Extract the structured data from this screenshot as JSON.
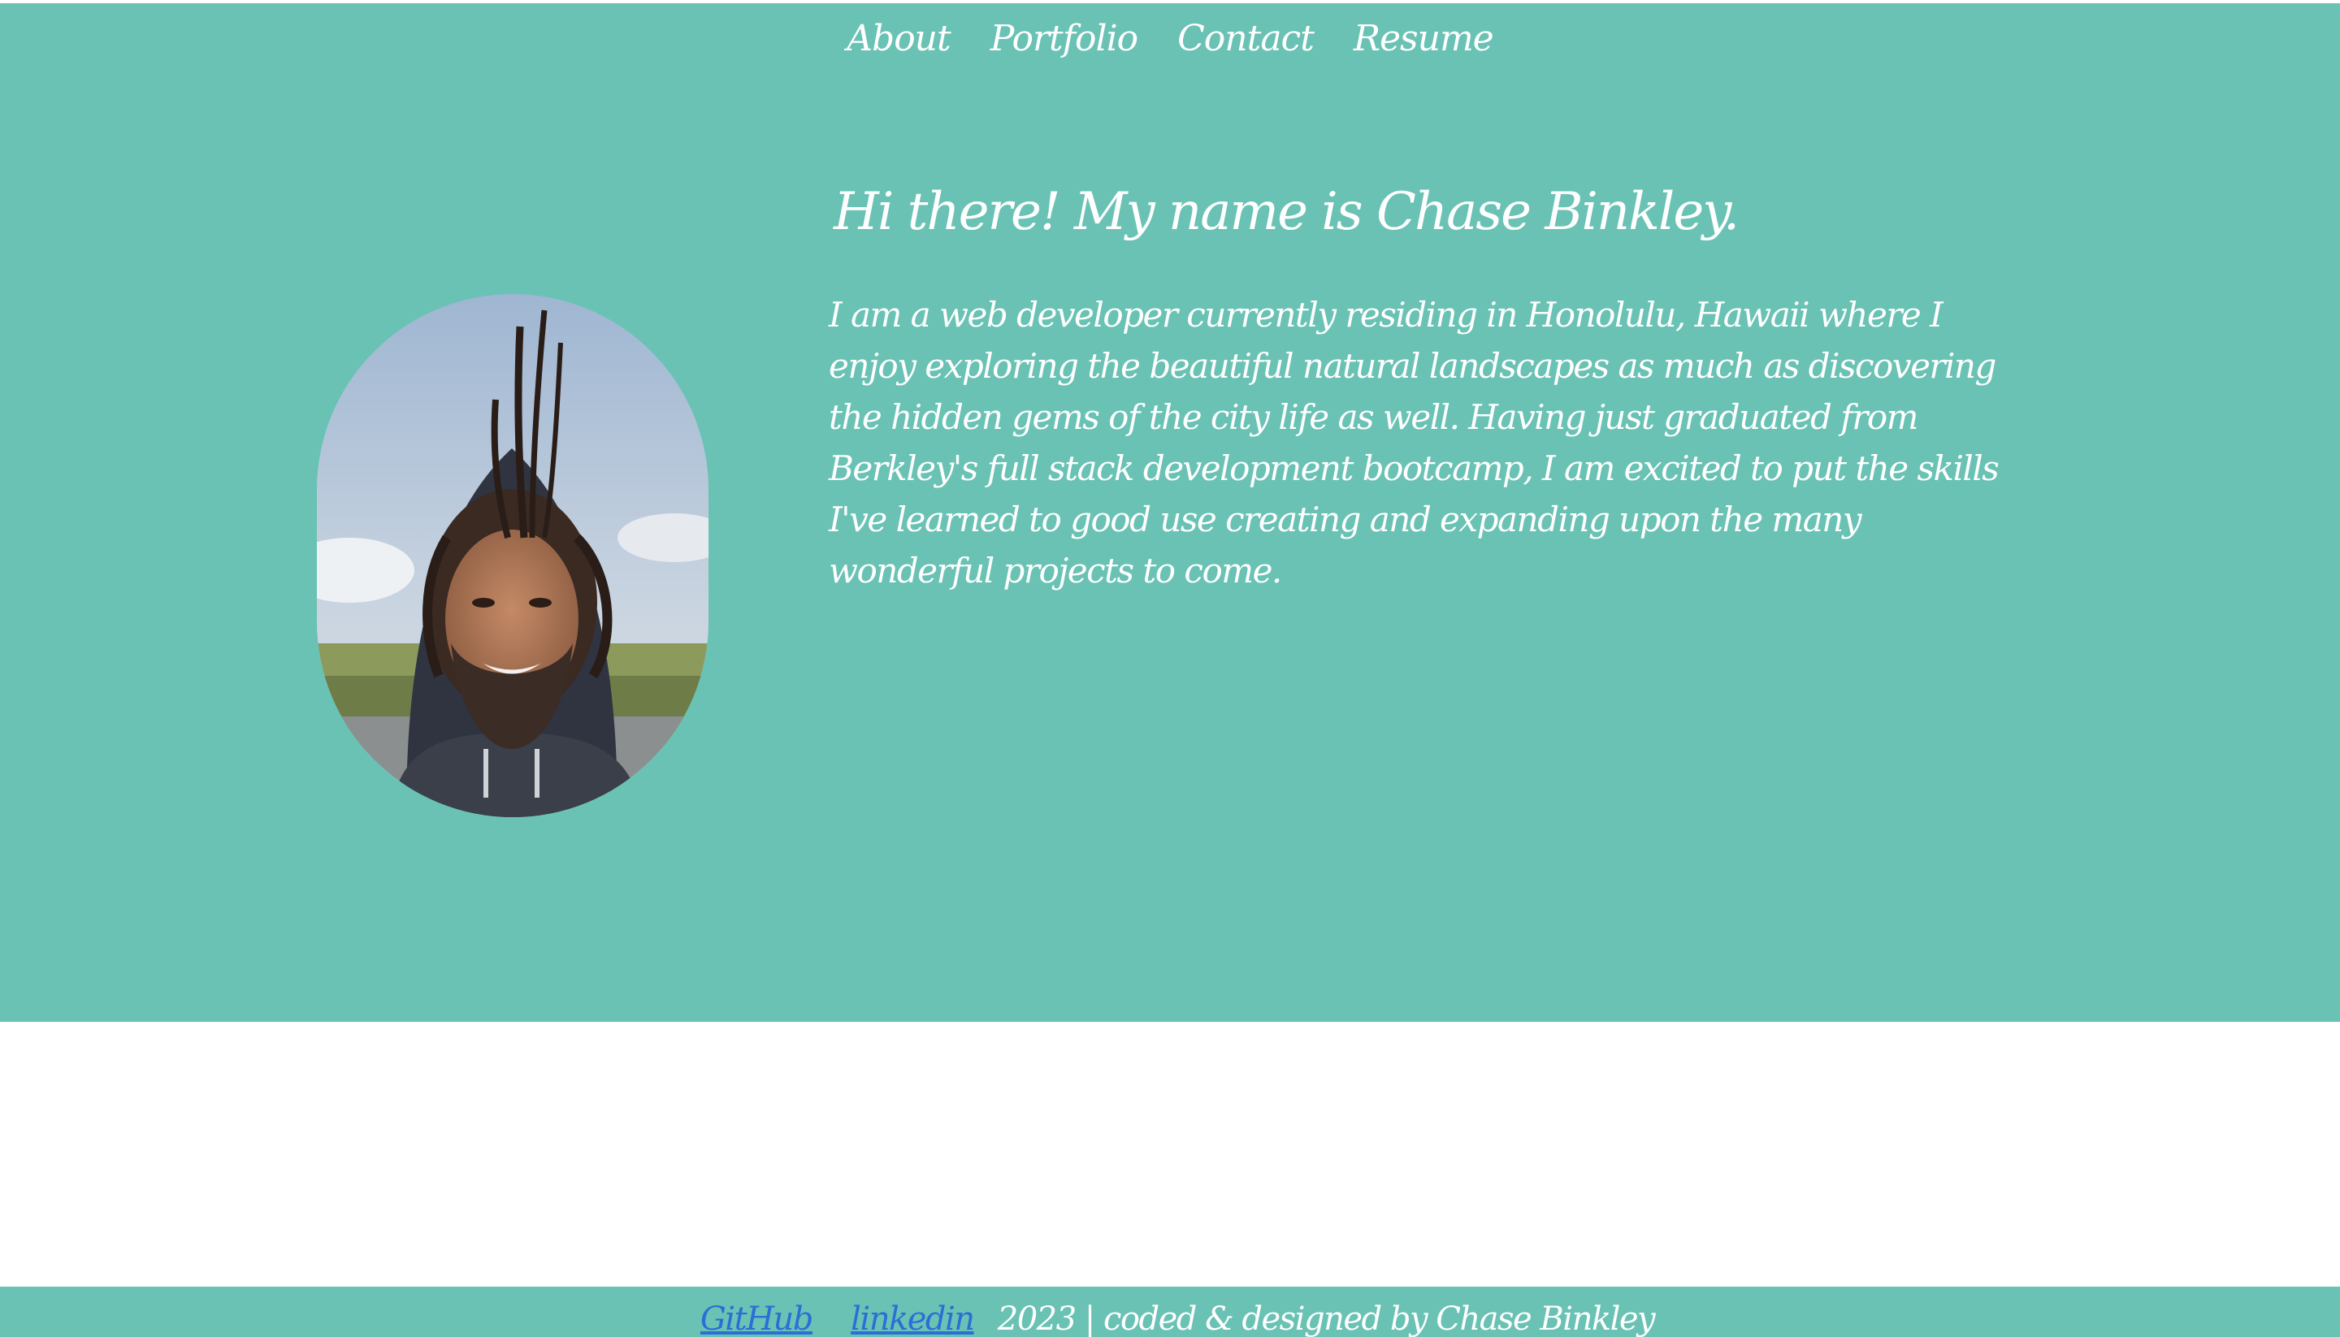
{
  "nav": {
    "items": [
      {
        "label": "About"
      },
      {
        "label": "Portfolio"
      },
      {
        "label": "Contact"
      },
      {
        "label": "Resume"
      }
    ]
  },
  "hero": {
    "headline": "Hi there! My name is Chase Binkley.",
    "bio": "I am a web developer currently residing in Honolulu, Hawaii where I enjoy exploring the beautiful natural landscapes as much as discovering the hidden gems of the city life as well. Having just graduated from Berkley's full stack development bootcamp, I am excited to put the skills I've learned to good use creating and expanding upon the many wonderful projects to come.",
    "portrait_icon": "portrait-photo"
  },
  "footer": {
    "github_label": "GitHub",
    "linkedin_label": "linkedin",
    "copyright": "2023 | coded & designed by Chase Binkley"
  },
  "colors": {
    "accent": "#6ac2b4",
    "link": "#2a6fd6",
    "text": "#ffffff"
  }
}
